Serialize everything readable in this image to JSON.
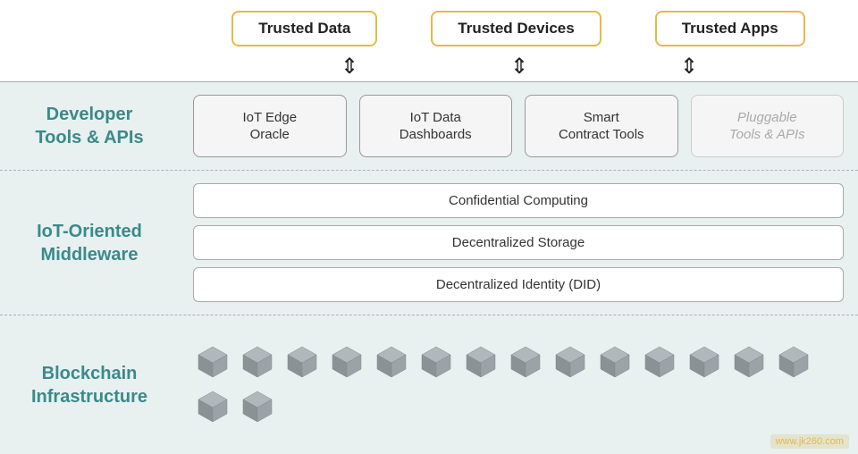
{
  "trusted_labels": [
    {
      "id": "trusted-data",
      "text": "Trusted Data"
    },
    {
      "id": "trusted-devices",
      "text": "Trusted Devices"
    },
    {
      "id": "trusted-apps",
      "text": "Trusted Apps"
    }
  ],
  "layers": {
    "developer": {
      "label": "Developer\nTools & APIs",
      "tools": [
        {
          "id": "iot-edge-oracle",
          "text": "IoT Edge\nOracle",
          "faded": false
        },
        {
          "id": "iot-data-dashboards",
          "text": "IoT Data\nDashboards",
          "faded": false
        },
        {
          "id": "smart-contract-tools",
          "text": "Smart\nContract Tools",
          "faded": false
        },
        {
          "id": "pluggable-tools",
          "text": "Pluggable\nTools & APIs",
          "faded": true
        }
      ]
    },
    "middleware": {
      "label": "IoT-Oriented\nMiddleware",
      "items": [
        {
          "id": "confidential-computing",
          "text": "Confidential Computing"
        },
        {
          "id": "decentralized-storage",
          "text": "Decentralized Storage"
        },
        {
          "id": "decentralized-identity",
          "text": "Decentralized Identity (DID)"
        }
      ]
    },
    "blockchain": {
      "label": "Blockchain\nInfrastructure"
    }
  },
  "watermark": "www.jk260.com"
}
